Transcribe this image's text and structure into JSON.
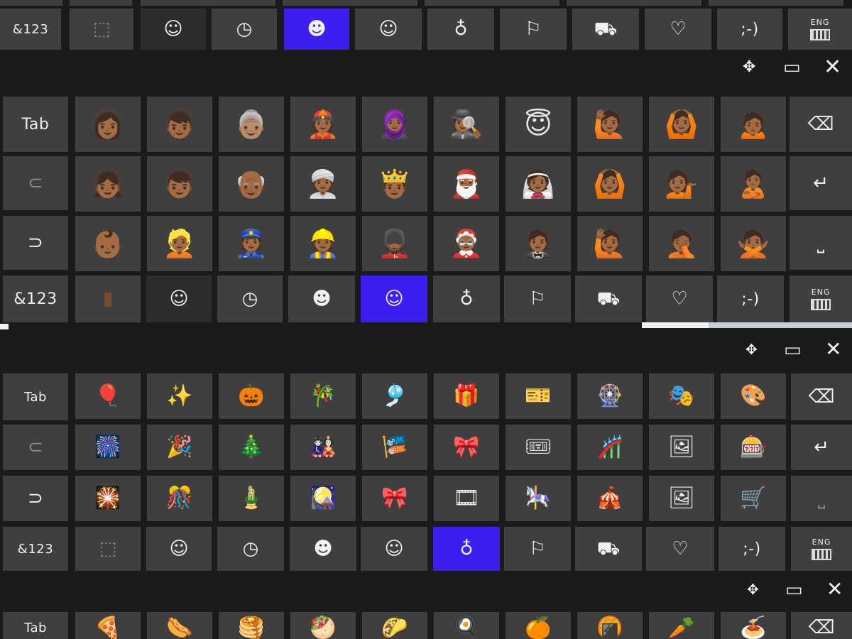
{
  "keys": {
    "tab": "Tab",
    "numsym": "&123",
    "eng": "ENG",
    "emoticon": ";-)"
  },
  "icons": {
    "back_arrow": "‹",
    "forward_arrow": "›",
    "backspace": "⌫",
    "enter": "↵",
    "space": "⎵",
    "move": "✥",
    "dock": "▭",
    "close": "✕",
    "smiley": "☺",
    "clock": "🕓",
    "laugh": "😃",
    "person": "🧑",
    "balloon_pin": "🎈",
    "flag": "🏁",
    "car": "🚗",
    "heart": "♡",
    "recent": "⬚"
  },
  "emoji_people": [
    [
      "👩🏾",
      "👦🏾",
      "👵🏽",
      "👲🏾",
      "🧕🏾",
      "🕵🏾",
      "😇",
      "🙋🏾",
      "🙆🏾",
      "🙍🏾"
    ],
    [
      "👧🏾",
      "👦🏾",
      "👴🏾",
      "👳🏾",
      "🤴🏾",
      "🎅🏾",
      "👰🏾",
      "🙆🏾",
      "💁🏾",
      "🙎🏾"
    ],
    [
      "👶🏾",
      "👱🏾",
      "👮🏾",
      "👷🏾",
      "💂🏾",
      "🤶🏾",
      "🤵🏾",
      "🙋🏾",
      "🤦🏾",
      "🙅🏾"
    ]
  ],
  "emoji_activities": [
    [
      "🎈",
      "✨",
      "🎃",
      "🎋",
      "🎐",
      "🎁",
      "🎫",
      "🎡",
      "🎭",
      "🎨"
    ],
    [
      "🎆",
      "🎉",
      "🎄",
      "🎎",
      "🎏",
      "🎀",
      "🎟",
      "🎢",
      "🖼",
      "🎰"
    ],
    [
      "🎇",
      "🎊",
      "🎍",
      "🎑",
      "🎀",
      "🎞",
      "🎠",
      "🎪",
      "🖼",
      "🛒"
    ]
  ],
  "emoji_food": [
    "🍕",
    "🌭",
    "🥞",
    "🥙",
    "🌮",
    "🍳",
    "🍊",
    "🍘",
    "🥕",
    "🍝"
  ]
}
